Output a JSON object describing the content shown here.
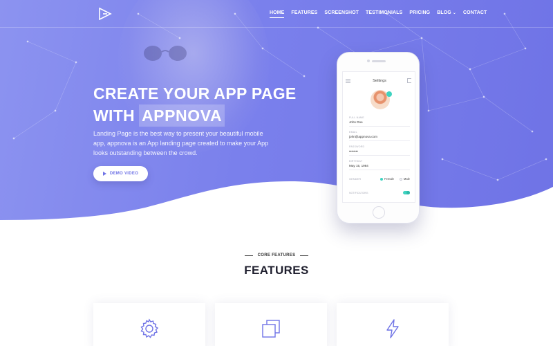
{
  "nav": {
    "items": [
      {
        "label": "HOME",
        "active": true
      },
      {
        "label": "FEATURES"
      },
      {
        "label": "SCREENSHOT"
      },
      {
        "label": "TESTIMONIALS"
      },
      {
        "label": "PRICING"
      },
      {
        "label": "BLOG",
        "dropdown": true
      },
      {
        "label": "CONTACT"
      }
    ]
  },
  "hero": {
    "title_line1": "CREATE YOUR APP PAGE",
    "title_with": "WITH",
    "title_brand": "APPNOVA",
    "description": "Landing Page is the best way to present your beautiful mobile app, appnova is an App landing page created to make your App looks outstanding between the crowd.",
    "demo_button": "DEMO VIDEO"
  },
  "phone": {
    "screen_title": "Settings",
    "fields": [
      {
        "label": "FULL NAME",
        "value": "John Doe"
      },
      {
        "label": "EMAIL",
        "value": "john@appnova.com"
      },
      {
        "label": "PASSWORD",
        "value": "••••••••"
      },
      {
        "label": "BIRTHDAY",
        "value": "May 15, 1984"
      }
    ],
    "gender": {
      "label": "GENDER",
      "options": [
        "Female",
        "Male"
      ],
      "selected": "Female"
    },
    "notifications": {
      "label": "NOTIFICATIONS",
      "enabled": true
    }
  },
  "features": {
    "eyebrow": "CORE FEATURES",
    "title": "FEATURES",
    "cards": [
      {
        "icon": "gear-icon"
      },
      {
        "icon": "copy-icon"
      },
      {
        "icon": "lightning-icon"
      }
    ]
  },
  "colors": {
    "primary": "#6f73e6",
    "accent": "#3ed3c0",
    "text_dark": "#1f1f2e"
  }
}
